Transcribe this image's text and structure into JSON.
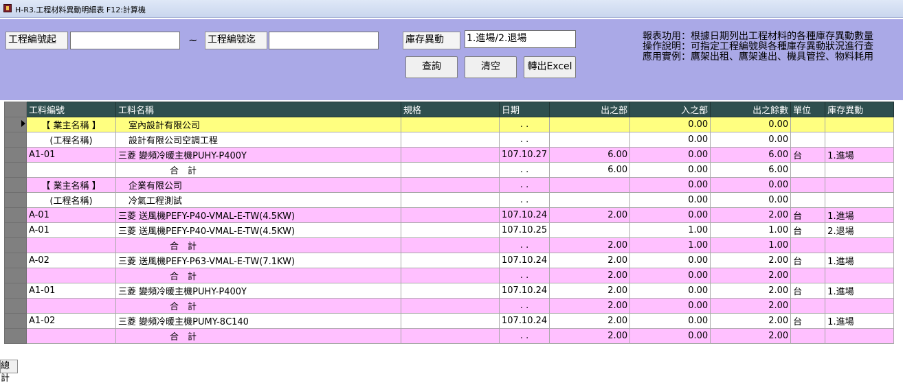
{
  "window": {
    "title": "H-R3.工程材料異動明細表  F12:計算機"
  },
  "filters": {
    "project_from_label": "工程編號起",
    "project_from_value": "",
    "tilde": "~",
    "project_to_label": "工程編號迄",
    "project_to_value": "",
    "stock_change_label": "庫存異動",
    "stock_change_value": "1.進場/2.退場"
  },
  "buttons": {
    "query": "查詢",
    "clear": "清空",
    "export": "轉出Excel"
  },
  "info": {
    "line1": "報表功用：根據日期列出工程材料的各種庫存異動數量",
    "line2": "操作說明：可指定工程編號與各種庫存異動狀況進行查",
    "line3": "應用實例：鷹架出租、鷹架進出、機具管控、物料耗用"
  },
  "table": {
    "headers": [
      "工料編號",
      "工料名稱",
      "規格",
      "日期",
      "出之部",
      "入之部",
      "出之餘數",
      "單位",
      "庫存異動"
    ],
    "rows": [
      {
        "style": "yellow",
        "cells": [
          "【 業主名稱 】",
          "室內設計有限公司",
          "",
          ". .",
          "",
          "0.00",
          "0.00",
          "",
          ""
        ]
      },
      {
        "style": "white",
        "cells": [
          "(工程名稱)",
          "設計有限公司空調工程",
          "",
          ". .",
          "",
          "0.00",
          "0.00",
          "",
          ""
        ]
      },
      {
        "style": "pink",
        "cells": [
          "A1-01",
          "三菱 變頻冷暖主機PUHY-P400Y",
          "",
          "107.10.27",
          "6.00",
          "0.00",
          "6.00",
          "台",
          "1.進場"
        ]
      },
      {
        "style": "white",
        "cells": [
          "",
          "合　計",
          "",
          ". .",
          "6.00",
          "0.00",
          "6.00",
          "",
          ""
        ]
      },
      {
        "style": "pink",
        "cells": [
          "【 業主名稱 】",
          "企業有限公司",
          "",
          ". .",
          "",
          "0.00",
          "0.00",
          "",
          ""
        ]
      },
      {
        "style": "white",
        "cells": [
          "(工程名稱)",
          "冷氣工程測試",
          "",
          ". .",
          "",
          "0.00",
          "0.00",
          "",
          ""
        ]
      },
      {
        "style": "pink",
        "cells": [
          "A-01",
          "三菱 送風機PEFY-P40-VMAL-E-TW(4.5KW)",
          "",
          "107.10.24",
          "2.00",
          "0.00",
          "2.00",
          "台",
          "1.進場"
        ]
      },
      {
        "style": "white",
        "cells": [
          "A-01",
          "三菱 送風機PEFY-P40-VMAL-E-TW(4.5KW)",
          "",
          "107.10.25",
          "",
          "1.00",
          "1.00",
          "台",
          "2.退場"
        ]
      },
      {
        "style": "pink",
        "cells": [
          "",
          "合　計",
          "",
          ". .",
          "2.00",
          "1.00",
          "1.00",
          "",
          ""
        ]
      },
      {
        "style": "white",
        "cells": [
          "A-02",
          "三菱 送風機PEFY-P63-VMAL-E-TW(7.1KW)",
          "",
          "107.10.24",
          "2.00",
          "0.00",
          "2.00",
          "台",
          "1.進場"
        ]
      },
      {
        "style": "pink",
        "cells": [
          "",
          "合　計",
          "",
          ". .",
          "2.00",
          "0.00",
          "2.00",
          "",
          ""
        ]
      },
      {
        "style": "white",
        "cells": [
          "A1-01",
          "三菱 變頻冷暖主機PUHY-P400Y",
          "",
          "107.10.24",
          "2.00",
          "0.00",
          "2.00",
          "台",
          "1.進場"
        ]
      },
      {
        "style": "pink",
        "cells": [
          "",
          "合　計",
          "",
          ". .",
          "2.00",
          "0.00",
          "2.00",
          "",
          ""
        ]
      },
      {
        "style": "white",
        "cells": [
          "A1-02",
          "三菱 變頻冷暖主機PUMY-8C140",
          "",
          "107.10.24",
          "2.00",
          "0.00",
          "2.00",
          "台",
          "1.進場"
        ]
      },
      {
        "style": "pink",
        "cells": [
          "",
          "合　計",
          "",
          ". .",
          "2.00",
          "0.00",
          "2.00",
          "",
          ""
        ]
      }
    ]
  },
  "footer": {
    "total_label": "總計"
  }
}
